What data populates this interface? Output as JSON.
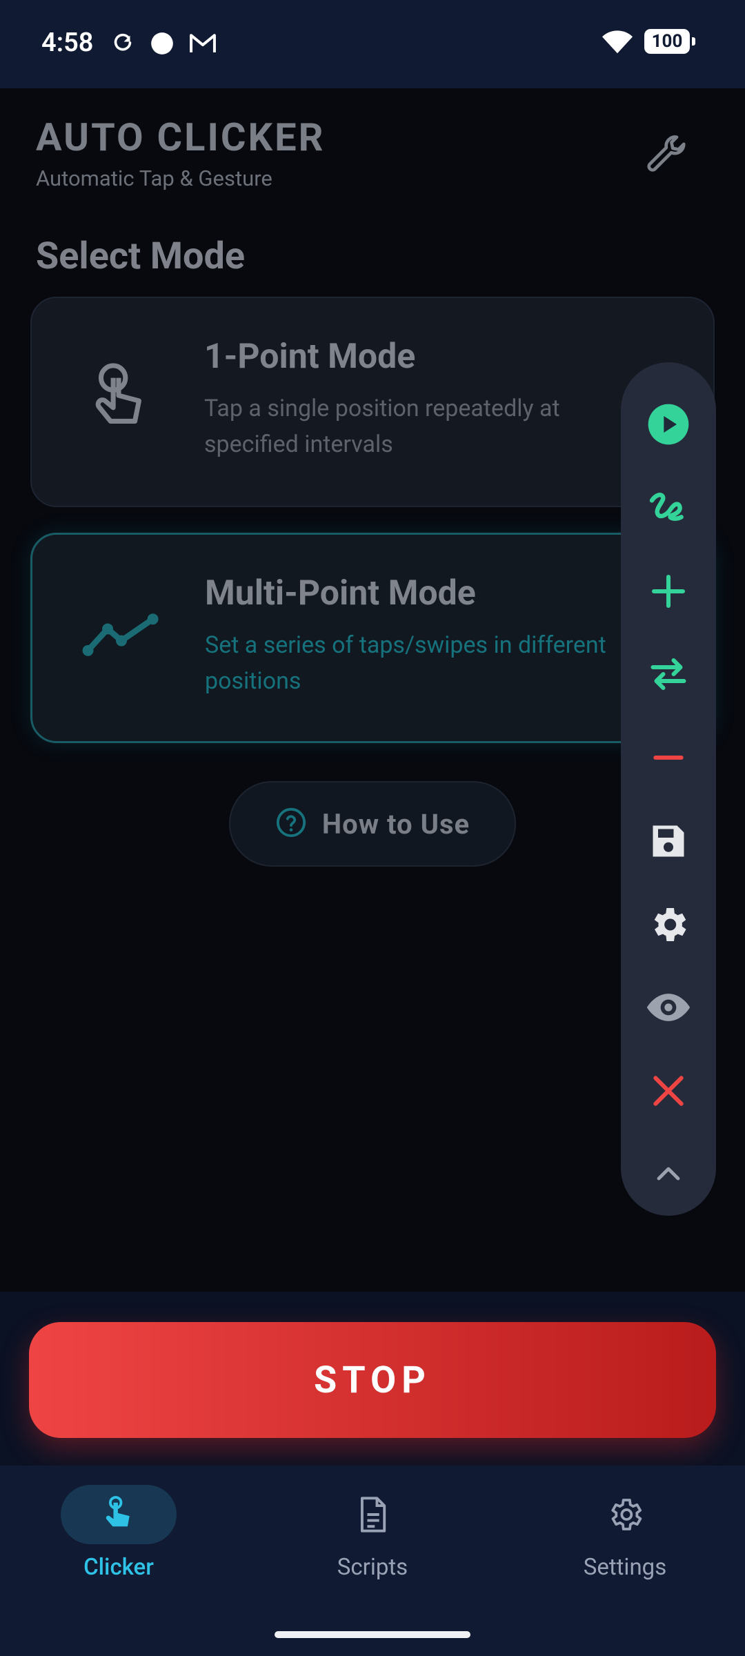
{
  "status_bar": {
    "time": "4:58",
    "icons": [
      "sync-icon",
      "circle-icon",
      "gmail-icon",
      "wifi-icon"
    ],
    "battery": "100"
  },
  "header": {
    "title": "AUTO CLICKER",
    "subtitle": "Automatic Tap & Gesture",
    "tools_icon": "wrench-icon"
  },
  "section": {
    "title": "Select Mode"
  },
  "modes": [
    {
      "title": "1-Point Mode",
      "description": "Tap a single position repeatedly at specified intervals",
      "icon": "single-tap-icon",
      "selected": false
    },
    {
      "title": "Multi-Point Mode",
      "description": "Set a series of taps/swipes in different positions",
      "icon": "multi-point-icon",
      "selected": true
    }
  ],
  "help": {
    "label": "How to Use",
    "icon": "help-circle-icon"
  },
  "floating_toolbar": {
    "items": [
      "play-icon",
      "gesture-icon",
      "add-icon",
      "swap-icon",
      "remove-icon",
      "save-icon",
      "settings-icon",
      "eye-icon",
      "close-icon",
      "collapse-icon"
    ],
    "colors": {
      "accent": "#34d399",
      "danger": "#ef4444",
      "neutral": "#e5e7eb",
      "muted": "#9ca3af"
    }
  },
  "stop_button": {
    "label": "STOP",
    "color": "#ef4444"
  },
  "bottom_nav": {
    "items": [
      {
        "label": "Clicker",
        "icon": "tap-icon",
        "active": true
      },
      {
        "label": "Scripts",
        "icon": "document-icon",
        "active": false
      },
      {
        "label": "Settings",
        "icon": "gear-icon",
        "active": false
      }
    ],
    "active_color": "#2ec3e6"
  }
}
